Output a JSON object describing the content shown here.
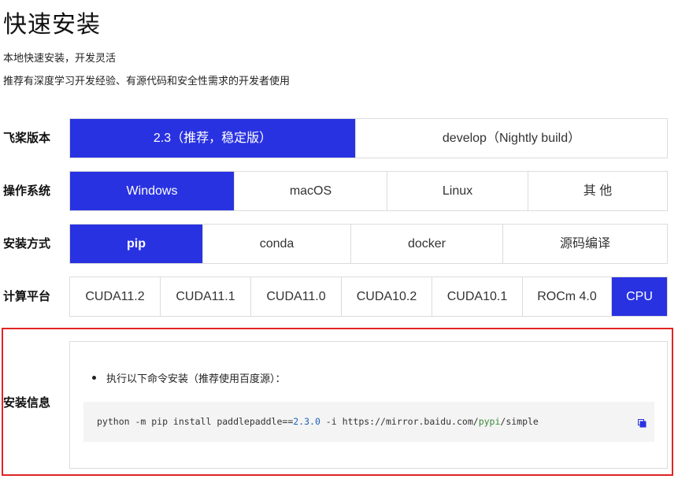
{
  "header": {
    "title": "快速安装",
    "subtitle1": "本地快速安装，开发灵活",
    "subtitle2": "推荐有深度学习开发经验、有源代码和安全性需求的开发者使用"
  },
  "rows": {
    "version": {
      "label": "飞桨版本",
      "options": [
        "2.3（推荐，稳定版）",
        "develop（Nightly build）"
      ],
      "selected": "2.3（推荐，稳定版）"
    },
    "os": {
      "label": "操作系统",
      "options": [
        "Windows",
        "macOS",
        "Linux",
        "其 他"
      ],
      "selected": "Windows"
    },
    "method": {
      "label": "安装方式",
      "options": [
        "pip",
        "conda",
        "docker",
        "源码编译"
      ],
      "selected": "pip"
    },
    "platform": {
      "label": "计算平台",
      "options": [
        "CUDA11.2",
        "CUDA11.1",
        "CUDA11.0",
        "CUDA10.2",
        "CUDA10.1",
        "ROCm 4.0",
        "CPU"
      ],
      "selected": "CPU"
    }
  },
  "install_info": {
    "label": "安装信息",
    "instruction": "执行以下命令安装（推荐使用百度源）：",
    "command": {
      "p1": "python -m pip install paddlepaddle==",
      "version": "2.3.0",
      "p2": " -i https:",
      "p3": "//mirror.baidu.com/",
      "p4": "pypi",
      "p5": "/simple"
    },
    "copy_icon": "copy-icon"
  },
  "colors": {
    "accent": "#2932e1",
    "highlight_border": "#e02424",
    "code_background": "#f4f4f4"
  }
}
